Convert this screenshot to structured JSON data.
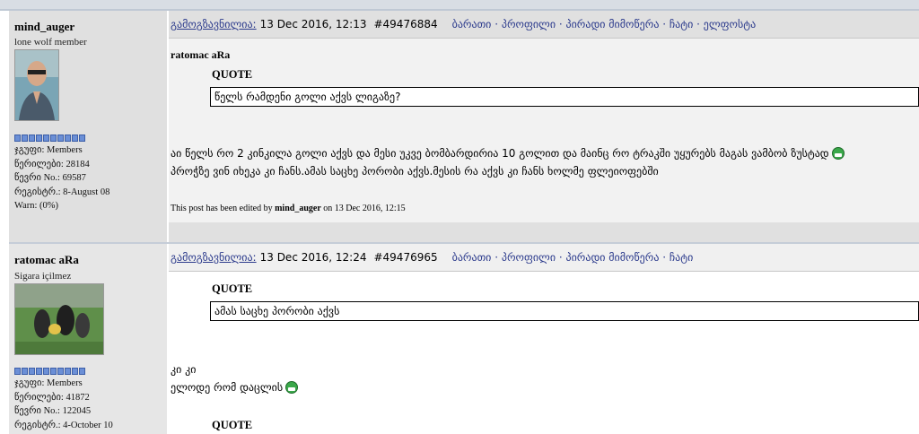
{
  "posts": [
    {
      "author": "mind_auger",
      "title": "lone wolf member",
      "stats": [
        "ჯგუფი: Members",
        "წერილები: 28184",
        "წევრი No.: 69587",
        "რეგისტრ.: 8-August 08",
        "Warn: (0%)"
      ],
      "header": {
        "link": "გამოგზავნილია:",
        "date": "13 Dec 2016, 12:13",
        "post_id": "#49476884",
        "nav": [
          "ბარათი",
          "პროფილი",
          "პირადი მიმოწერა",
          "ჩატი",
          "ელფოსტა"
        ]
      },
      "quote_author": "ratomac aRa",
      "quote_label": "QUOTE",
      "quote_text": "წელს რამდენი გოლი აქვს ლიგაზე?",
      "lines": [
        "აი წელს რო 2 კინკილა გოლი აქვს და მესი უკვე ბომბარდირია 10 გოლით და მაინც რო ტრაკში უყურებს მაგას ვამბობ ზუსტად",
        "პროჭზე ვინ იხეკა კი ჩანს.ამას საცხე პორობი აქვს.მესის რა აქვს კი ჩანს ხოლმე ფლეიოფებში"
      ],
      "edited": {
        "prefix": "This post has been edited by",
        "by": "mind_auger",
        "when": "on 13 Dec 2016, 12:15"
      }
    },
    {
      "author": "ratomac aRa",
      "title": "Sigara içilmez",
      "stats": [
        "ჯგუფი: Members",
        "წერილები: 41872",
        "წევრი No.: 122045",
        "რეგისტრ.: 4-October 10"
      ],
      "header": {
        "link": "გამოგზავნილია:",
        "date": "13 Dec 2016, 12:24",
        "post_id": "#49476965",
        "nav": [
          "ბარათი",
          "პროფილი",
          "პირადი მიმოწერა",
          "ჩატი"
        ]
      },
      "quote_label": "QUOTE",
      "quote_text": "ამას საცხე პორობი აქვს",
      "lines": [
        "კი კი",
        "ელოდე რომ დაცლის"
      ],
      "quote_label_2": "QUOTE"
    }
  ]
}
